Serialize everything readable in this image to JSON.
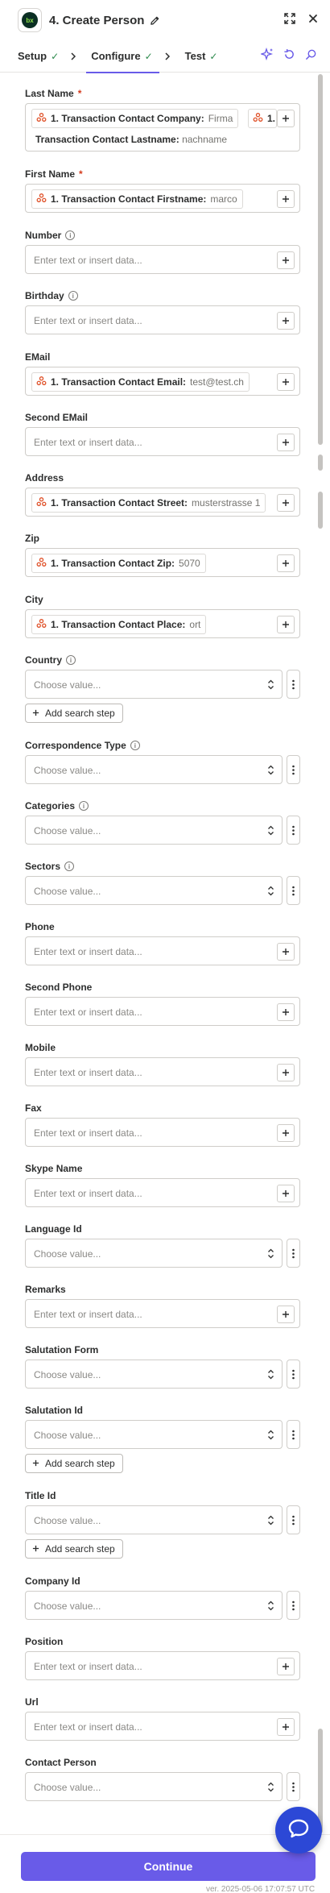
{
  "header": {
    "app_logo_text": "bx",
    "title": "4. Create Person"
  },
  "tabs": [
    {
      "label": "Setup"
    },
    {
      "label": "Configure"
    },
    {
      "label": "Test"
    }
  ],
  "fields": {
    "last_name": {
      "label": "Last Name",
      "required": "*",
      "pill1_source": "1. Transaction Contact Company:",
      "pill1_value": "Firma",
      "pill2_source": "1.",
      "line2_source": "Transaction Contact Lastname:",
      "line2_value": "nachname"
    },
    "first_name": {
      "label": "First Name",
      "required": "*",
      "source": "1. Transaction Contact Firstname:",
      "value": "marco"
    },
    "number": {
      "label": "Number",
      "placeholder": "Enter text or insert data..."
    },
    "birthday": {
      "label": "Birthday",
      "placeholder": "Enter text or insert data..."
    },
    "email": {
      "label": "EMail",
      "source": "1. Transaction Contact Email:",
      "value": "test@test.ch"
    },
    "second_email": {
      "label": "Second EMail",
      "placeholder": "Enter text or insert data..."
    },
    "address": {
      "label": "Address",
      "source": "1. Transaction Contact Street:",
      "value": "musterstrasse 1"
    },
    "zip": {
      "label": "Zip",
      "source": "1. Transaction Contact Zip:",
      "value": "5070"
    },
    "city": {
      "label": "City",
      "source": "1. Transaction Contact Place:",
      "value": "ort"
    },
    "country": {
      "label": "Country",
      "placeholder": "Choose value...",
      "search_step": "Add search step"
    },
    "correspondence_type": {
      "label": "Correspondence Type",
      "placeholder": "Choose value..."
    },
    "categories": {
      "label": "Categories",
      "placeholder": "Choose value..."
    },
    "sectors": {
      "label": "Sectors",
      "placeholder": "Choose value..."
    },
    "phone": {
      "label": "Phone",
      "placeholder": "Enter text or insert data..."
    },
    "second_phone": {
      "label": "Second Phone",
      "placeholder": "Enter text or insert data..."
    },
    "mobile": {
      "label": "Mobile",
      "placeholder": "Enter text or insert data..."
    },
    "fax": {
      "label": "Fax",
      "placeholder": "Enter text or insert data..."
    },
    "skype_name": {
      "label": "Skype Name",
      "placeholder": "Enter text or insert data..."
    },
    "language_id": {
      "label": "Language Id",
      "placeholder": "Choose value..."
    },
    "remarks": {
      "label": "Remarks",
      "placeholder": "Enter text or insert data..."
    },
    "salutation_form": {
      "label": "Salutation Form",
      "placeholder": "Choose value..."
    },
    "salutation_id": {
      "label": "Salutation Id",
      "placeholder": "Choose value...",
      "search_step": "Add search step"
    },
    "title_id": {
      "label": "Title Id",
      "placeholder": "Choose value...",
      "search_step": "Add search step"
    },
    "company_id": {
      "label": "Company Id",
      "placeholder": "Choose value..."
    },
    "position": {
      "label": "Position",
      "placeholder": "Enter text or insert data..."
    },
    "url": {
      "label": "Url",
      "placeholder": "Enter text or insert data..."
    },
    "contact_person": {
      "label": "Contact Person",
      "placeholder": "Choose value..."
    }
  },
  "footer": {
    "continue_label": "Continue",
    "version": "ver. 2025-05-06 17:07:57 UTC"
  },
  "colors": {
    "accent": "#695be8",
    "success": "#2c8a4c",
    "required": "#d43a1c",
    "trigger_orange": "#e0532b",
    "chat_blue": "#2c48d6"
  }
}
